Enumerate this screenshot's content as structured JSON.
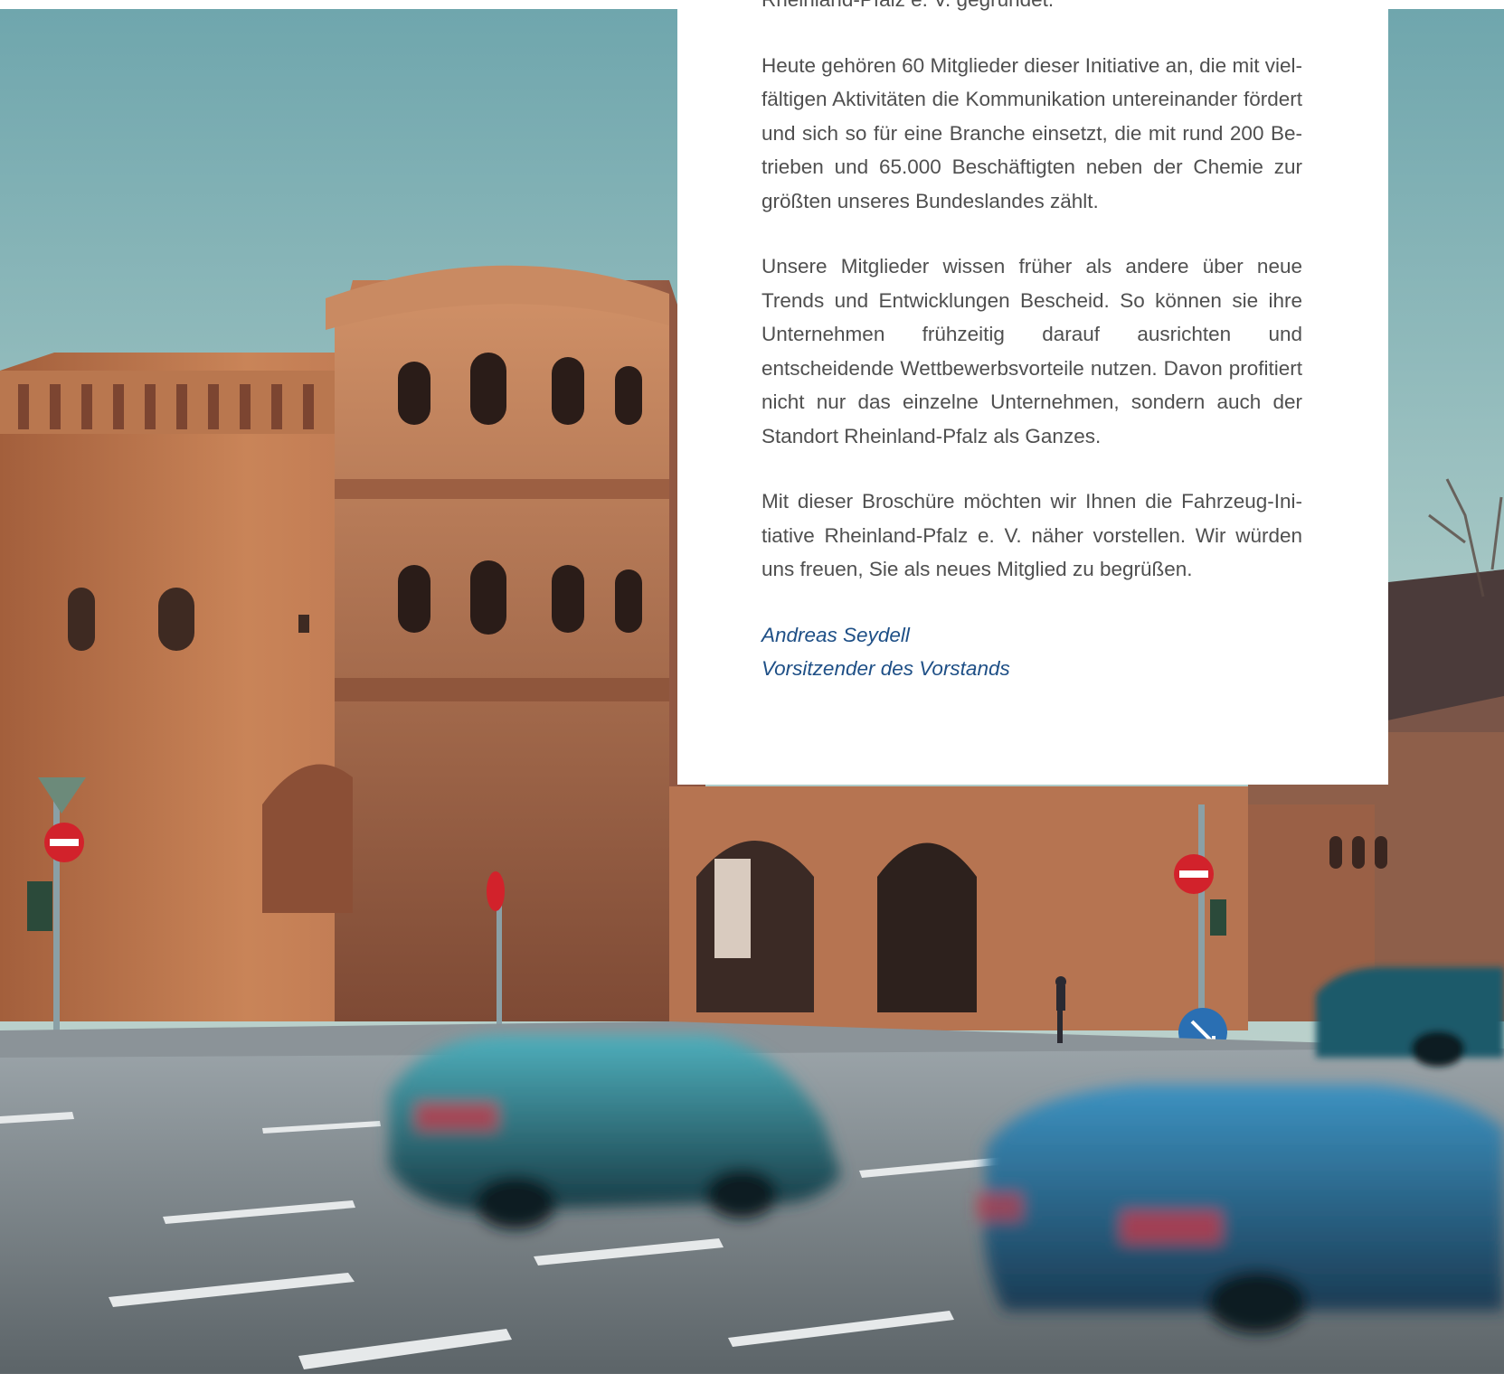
{
  "letter": {
    "paragraphs": [
      "Rheinland-Pfalz e. V. gegründet.",
      "Heute gehören 60 Mitglieder dieser Initiative an, die mit viel­fältigen Aktivitäten die Kommunikation untereinander fördert und sich so für eine Branche einsetzt, die mit rund 200 Be­trieben und 65.000 Beschäftigten neben der Chemie zur größten unseres Bundeslandes zählt.",
      "Unsere Mitglieder wissen früher als andere über neue Trends und Entwicklungen Bescheid. So können sie ihre Unterneh­men frühzeitig darauf ausrichten und entscheidende Wettbe­werbsvorteile nutzen. Davon profitiert nicht nur das einzelne Unternehmen, sondern auch der Standort Rheinland-Pfalz als Ganzes.",
      "Mit dieser Broschüre möchten wir Ihnen die Fahrzeug-Ini­tiative Rheinland-Pfalz e. V. näher vorstellen. Wir würden uns freuen, Sie als neues Mitglied zu begrüßen."
    ],
    "signature": {
      "name": "Andreas Seydell",
      "role": "Vorsitzender des Vorstands"
    }
  },
  "colors": {
    "body_text": "#4f4f4f",
    "signature": "#1e4f86",
    "card": "#ffffff"
  },
  "photo": {
    "subject": "Porta Nigra in Trier with blurred cars on the road"
  }
}
